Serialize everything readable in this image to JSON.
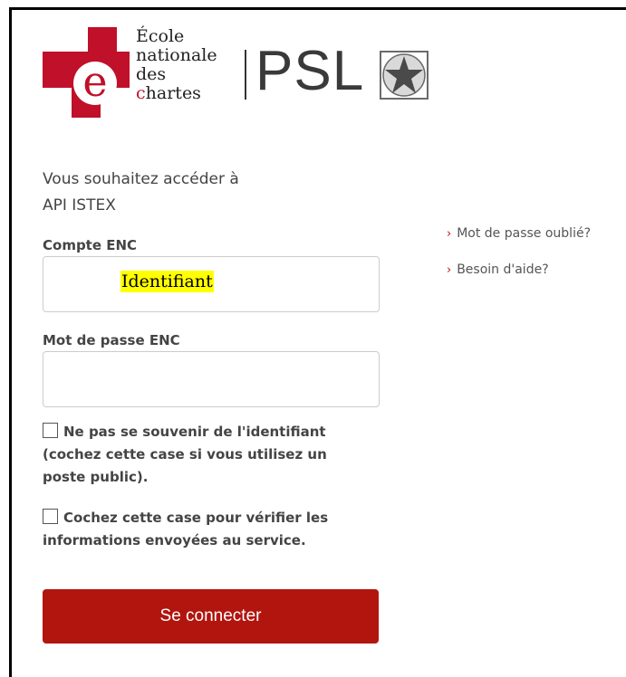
{
  "logo": {
    "line1": "École",
    "line2": "nationale",
    "line3": "des",
    "line4_first": "c",
    "line4_rest": "hartes",
    "psl": "PSL",
    "mark_color": "#c0102a"
  },
  "intro": {
    "line1": "Vous souhaitez accéder à",
    "line2": "API ISTEX"
  },
  "login": {
    "account_label": "Compte ENC",
    "account_placeholder": "Identifiant",
    "password_label": "Mot de passe ENC",
    "password_value": ""
  },
  "options": {
    "forget_me": {
      "checked": false,
      "label": "Ne pas se souvenir de l'identifiant (cochez cette case si vous utilisez un poste public)."
    },
    "verify": {
      "checked": false,
      "label": "Cochez cette case pour vérifier les informations envoyées au service."
    }
  },
  "submit_label": "Se connecter",
  "links": {
    "forgot_password": "Mot de passe oublié?",
    "need_help": "Besoin d'aide?"
  },
  "colors": {
    "accent": "#b1150e",
    "text": "#444444",
    "highlight": "#ffff00"
  },
  "icons": {
    "chevron": "chevron-right-icon",
    "psl_star": "star-icon"
  }
}
